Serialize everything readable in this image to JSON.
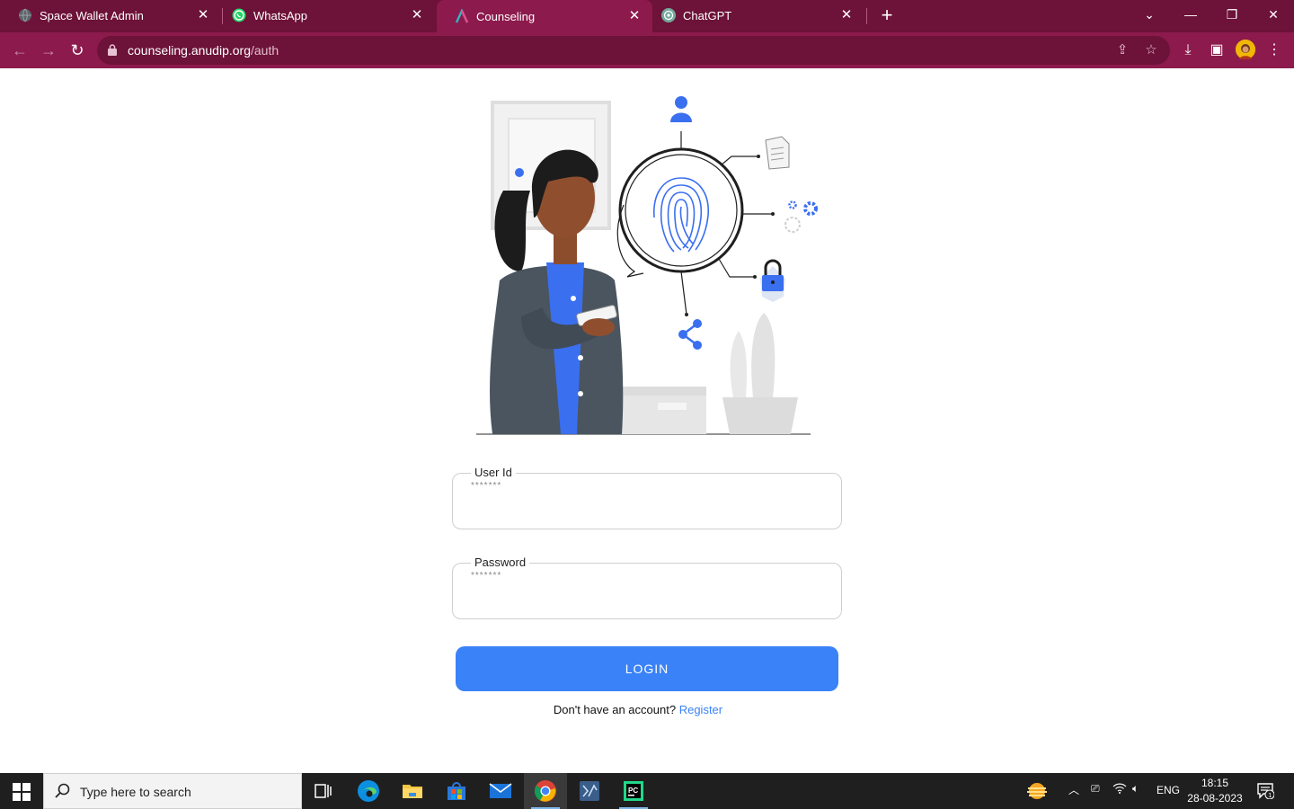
{
  "browser": {
    "tabs": [
      {
        "title": "Space Wallet Admin",
        "icon": "globe-icon",
        "active": false
      },
      {
        "title": "WhatsApp",
        "icon": "whatsapp-icon",
        "active": false
      },
      {
        "title": "Counseling",
        "icon": "anudip-icon",
        "active": true
      },
      {
        "title": "ChatGPT",
        "icon": "chatgpt-icon",
        "active": false
      }
    ],
    "url_host": "counseling.anudip.org",
    "url_path": "/auth"
  },
  "form": {
    "user_id_label": "User Id",
    "user_id_placeholder": "*******",
    "password_label": "Password",
    "password_placeholder": "*******",
    "login_label": "LOGIN",
    "no_account_text": "Don't have an account?",
    "register_link": "Register"
  },
  "taskbar": {
    "search_placeholder": "Type here to search",
    "language": "ENG",
    "time": "18:15",
    "date": "28-08-2023",
    "notification_count": "1"
  },
  "colors": {
    "chrome_dark": "#6d1238",
    "chrome_toolbar": "#8c1a4c",
    "accent": "#3a82f7"
  }
}
